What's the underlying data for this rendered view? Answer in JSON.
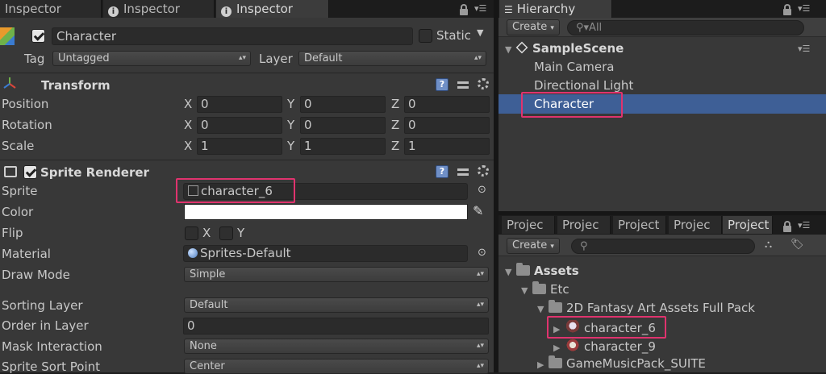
{
  "inspector_tabs": [
    {
      "label": "Inspector"
    },
    {
      "label": "Inspector"
    },
    {
      "label": "Inspector"
    }
  ],
  "hierarchy_tab": {
    "label": "Hierarchy"
  },
  "object": {
    "name": "Character",
    "static_label": "Static",
    "tag_label": "Tag",
    "tag_value": "Untagged",
    "layer_label": "Layer",
    "layer_value": "Default"
  },
  "transform": {
    "title": "Transform",
    "rows": [
      {
        "label": "Position",
        "x": "0",
        "y": "0",
        "z": "0"
      },
      {
        "label": "Rotation",
        "x": "0",
        "y": "0",
        "z": "0"
      },
      {
        "label": "Scale",
        "x": "1",
        "y": "1",
        "z": "1"
      }
    ],
    "axis_x": "X",
    "axis_y": "Y",
    "axis_z": "Z"
  },
  "sprite_renderer": {
    "title": "Sprite Renderer",
    "sprite_label": "Sprite",
    "sprite_value": "character_6",
    "color_label": "Color",
    "color_value": "#ffffff",
    "flip_label": "Flip",
    "flip_x": "X",
    "flip_y": "Y",
    "material_label": "Material",
    "material_value": "Sprites-Default",
    "draw_mode_label": "Draw Mode",
    "draw_mode_value": "Simple",
    "sorting_layer_label": "Sorting Layer",
    "sorting_layer_value": "Default",
    "order_label": "Order in Layer",
    "order_value": "0",
    "mask_label": "Mask Interaction",
    "mask_value": "None",
    "sort_point_label": "Sprite Sort Point",
    "sort_point_value": "Center"
  },
  "hierarchy": {
    "create_label": "Create",
    "search_placeholder": "All",
    "scene": "SampleScene",
    "items": [
      {
        "label": "Main Camera"
      },
      {
        "label": "Directional Light"
      },
      {
        "label": "Character"
      }
    ]
  },
  "project_tabs": [
    {
      "label": "Projec"
    },
    {
      "label": "Projec"
    },
    {
      "label": "Project"
    },
    {
      "label": "Projec"
    },
    {
      "label": "Project"
    }
  ],
  "project": {
    "create_label": "Create",
    "tree": [
      {
        "label": "Assets"
      },
      {
        "label": "Etc"
      },
      {
        "label": "2D Fantasy Art Assets Full Pack"
      },
      {
        "label": "character_6"
      },
      {
        "label": "character_9"
      },
      {
        "label": "GameMusicPack_SUITE"
      }
    ]
  },
  "colors": {
    "selection": "#3e5f96",
    "highlight_box": "#e0336e",
    "panel": "#383838"
  }
}
